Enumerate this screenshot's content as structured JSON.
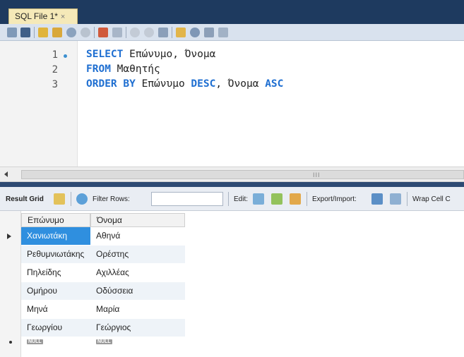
{
  "tab": {
    "title": "SQL File 1*",
    "close": "×"
  },
  "editor": {
    "line_numbers": [
      "1",
      "2",
      "3"
    ],
    "lines": [
      {
        "kw1": "SELECT",
        "text1": " Επώνυμο, Όνομα"
      },
      {
        "kw1": "FROM",
        "text1": " Μαθητής"
      },
      {
        "kw1": "ORDER BY",
        "text1": " Επώνυμο ",
        "kw2": "DESC",
        "text2": ", Όνομα ",
        "kw3": "ASC"
      }
    ]
  },
  "scrollbar": {
    "grip": "III"
  },
  "results_toolbar": {
    "result_grid": "Result Grid",
    "filter_rows": "Filter Rows:",
    "filter_value": "",
    "edit": "Edit:",
    "export_import": "Export/Import:",
    "wrap": "Wrap Cell C"
  },
  "grid": {
    "columns": [
      "Επώνυμο",
      "Όνομα"
    ],
    "rows": [
      [
        "Χανιωτάκη",
        "Αθηνά"
      ],
      [
        "Ρεθυμνιωτάκης",
        "Ορέστης"
      ],
      [
        "Πηλείδης",
        "Αχιλλέας"
      ],
      [
        "Ομήρου",
        "Οδύσσεια"
      ],
      [
        "Μηνά",
        "Μαρία"
      ],
      [
        "Γεωργίου",
        "Γεώργιος"
      ]
    ],
    "null_label": "NULL"
  },
  "colors": {
    "keyword": "#1f6fd1",
    "selection": "#2f8fdf",
    "tab_bg": "#f5e9b8",
    "frame": "#1e3a5f"
  },
  "icons": [
    "folder-icon",
    "save-icon",
    "lightning-icon",
    "lightning-cursor-icon",
    "magnifier-icon",
    "stop-icon",
    "toggle-error-icon",
    "grid-icon",
    "commit-icon",
    "rollback-icon",
    "auto-commit-icon",
    "beautify-icon",
    "find-icon",
    "invisible-chars-icon",
    "wrap-icon"
  ]
}
